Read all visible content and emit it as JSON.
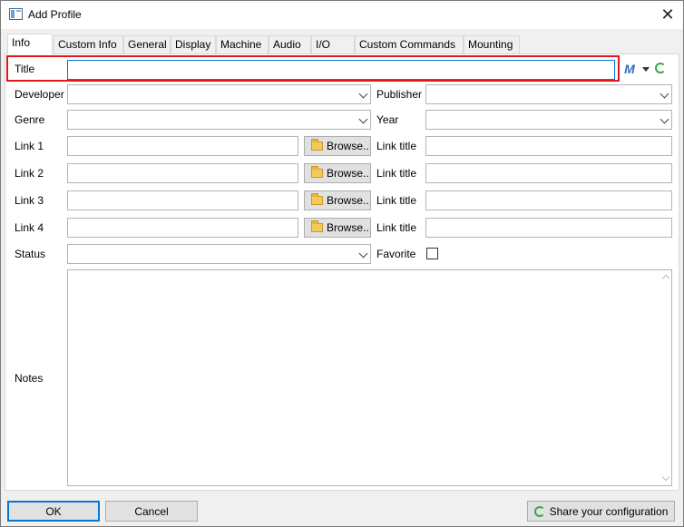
{
  "window": {
    "title": "Add Profile",
    "close_glyph": "✕",
    "icon": "app-window-icon"
  },
  "tabs": [
    {
      "label": "Info",
      "active": true
    },
    {
      "label": "Custom Info"
    },
    {
      "label": "General"
    },
    {
      "label": "Display"
    },
    {
      "label": "Machine"
    },
    {
      "label": "Audio"
    },
    {
      "label": "I/O"
    },
    {
      "label": "Custom Commands"
    },
    {
      "label": "Mounting"
    }
  ],
  "form": {
    "title_label": "Title",
    "title_value": "",
    "developer_label": "Developer",
    "developer_value": "",
    "publisher_label": "Publisher",
    "publisher_value": "",
    "genre_label": "Genre",
    "genre_value": "",
    "year_label": "Year",
    "year_value": "",
    "links": [
      {
        "label": "Link 1",
        "value": "",
        "browse": "Browse..",
        "title_label": "Link title",
        "title_value": ""
      },
      {
        "label": "Link 2",
        "value": "",
        "browse": "Browse..",
        "title_label": "Link title",
        "title_value": ""
      },
      {
        "label": "Link 3",
        "value": "",
        "browse": "Browse..",
        "title_label": "Link title",
        "title_value": ""
      },
      {
        "label": "Link 4",
        "value": "",
        "browse": "Browse..",
        "title_label": "Link title",
        "title_value": ""
      }
    ],
    "status_label": "Status",
    "status_value": "",
    "favorite_label": "Favorite",
    "favorite_checked": false,
    "notes_label": "Notes",
    "notes_value": "",
    "m_icon_glyph": "M"
  },
  "footer": {
    "ok_label": "OK",
    "cancel_label": "Cancel",
    "share_label": "Share your configuration"
  },
  "colors": {
    "highlight": "#e0181e",
    "focus": "#0078d7"
  }
}
